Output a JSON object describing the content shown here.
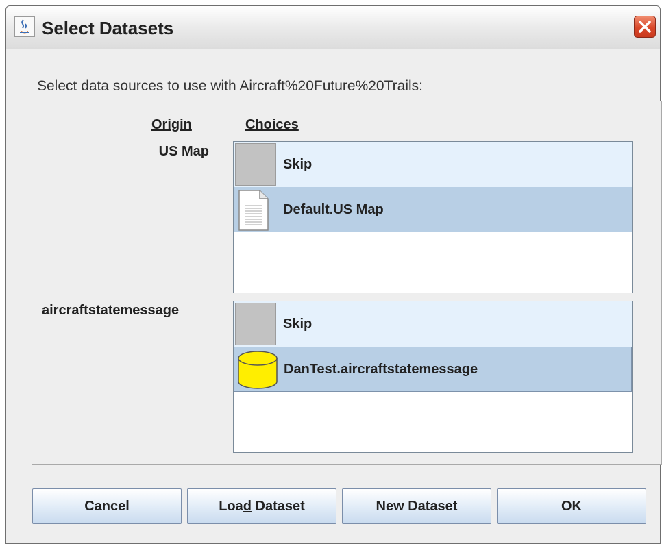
{
  "window": {
    "title": "Select Datasets",
    "close_icon": "close-x-icon",
    "app_icon": "java-coffee-icon"
  },
  "instruction": "Select data sources to use with Aircraft%20Future%20Trails:",
  "headers": {
    "origin": "Origin",
    "choices": "Choices"
  },
  "groups": [
    {
      "origin": "US Map",
      "choices": [
        {
          "label": "Skip",
          "icon": "skip-box-icon",
          "highlighted": true
        },
        {
          "label": "Default.US Map",
          "icon": "document-icon",
          "selected": true
        }
      ]
    },
    {
      "origin": "aircraftstatemessage",
      "choices": [
        {
          "label": "Skip",
          "icon": "skip-box-icon",
          "highlighted": true
        },
        {
          "label": "DanTest.aircraftstatemessage",
          "icon": "database-icon",
          "selected": true
        }
      ]
    }
  ],
  "buttons": {
    "cancel": "Cancel",
    "load_pre": "Loa",
    "load_mnemonic": "d",
    "load_post": " Dataset",
    "new_dataset": "New Dataset",
    "ok": "OK"
  },
  "colors": {
    "highlight_row": "#e5f1fc",
    "selected_row": "#b8cfe5",
    "window_bg": "#eeeeee",
    "database_fill": "#ffee00"
  }
}
